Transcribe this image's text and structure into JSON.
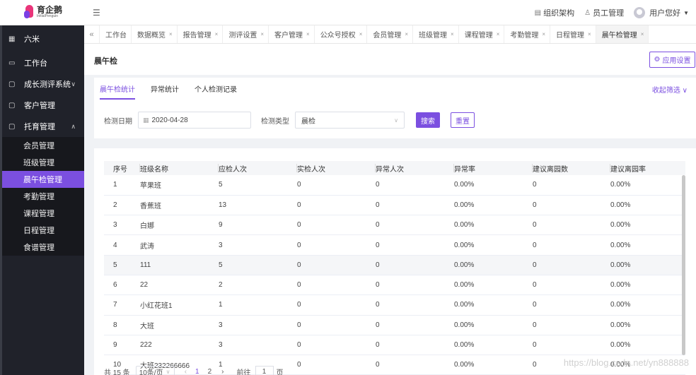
{
  "brand": {
    "name": "育企鹅",
    "subtitle": "InitialPenguin"
  },
  "topbar": {
    "org_label": "组织架构",
    "staff_label": "员工管理",
    "user_label": "用户您好"
  },
  "sidebar": {
    "org": "六米",
    "items": [
      {
        "label": "工作台",
        "icon": "monitor-icon"
      },
      {
        "label": "成长测评系统",
        "icon": "folder-icon",
        "arrow": "∨"
      },
      {
        "label": "客户管理",
        "icon": "folder-icon"
      },
      {
        "label": "托育管理",
        "icon": "folder-icon",
        "arrow": "∧"
      }
    ],
    "subitems": [
      "会员管理",
      "班级管理",
      "晨午检管理",
      "考勤管理",
      "课程管理",
      "日程管理",
      "食谱管理"
    ]
  },
  "tabs": [
    "工作台",
    "数据概览",
    "报告管理",
    "测评设置",
    "客户管理",
    "公众号授权",
    "会员管理",
    "班级管理",
    "课程管理",
    "考勤管理",
    "日程管理",
    "晨午检管理"
  ],
  "page": {
    "title": "晨午检",
    "settings_label": "应用设置"
  },
  "filter": {
    "subtabs": [
      "晨午检统计",
      "异常统计",
      "个人检测记录"
    ],
    "collapse_label": "收起筛选",
    "date_label": "检测日期",
    "date_value": "2020-04-28",
    "type_label": "检测类型",
    "type_value": "晨检",
    "search_label": "搜索",
    "reset_label": "重置"
  },
  "table": {
    "headers": [
      "序号",
      "班级名称",
      "应检人次",
      "实检人次",
      "异常人次",
      "异常率",
      "建议离园数",
      "建议离园率"
    ],
    "rows": [
      [
        "1",
        "苹果班",
        "5",
        "0",
        "0",
        "0.00%",
        "0",
        "0.00%"
      ],
      [
        "2",
        "香蕉班",
        "13",
        "0",
        "0",
        "0.00%",
        "0",
        "0.00%"
      ],
      [
        "3",
        "白娜",
        "9",
        "0",
        "0",
        "0.00%",
        "0",
        "0.00%"
      ],
      [
        "4",
        "武涛",
        "3",
        "0",
        "0",
        "0.00%",
        "0",
        "0.00%"
      ],
      [
        "5",
        "111",
        "5",
        "0",
        "0",
        "0.00%",
        "0",
        "0.00%"
      ],
      [
        "6",
        "22",
        "2",
        "0",
        "0",
        "0.00%",
        "0",
        "0.00%"
      ],
      [
        "7",
        "小红花班1",
        "1",
        "0",
        "0",
        "0.00%",
        "0",
        "0.00%"
      ],
      [
        "8",
        "大班",
        "3",
        "0",
        "0",
        "0.00%",
        "0",
        "0.00%"
      ],
      [
        "9",
        "222",
        "3",
        "0",
        "0",
        "0.00%",
        "0",
        "0.00%"
      ],
      [
        "10",
        "大班232266666",
        "1",
        "0",
        "0",
        "0.00%",
        "0",
        "0.00%"
      ]
    ]
  },
  "pager": {
    "total": "共 15 条",
    "page_size": "10条/页",
    "pages": [
      "1",
      "2"
    ],
    "goto_label": "前往",
    "goto_value": "1",
    "page_unit": "页"
  },
  "watermark": "https://blog.csdn.net/yn888888",
  "colors": {
    "accent": "#7b4fe0",
    "sidebar": "#20222a"
  }
}
